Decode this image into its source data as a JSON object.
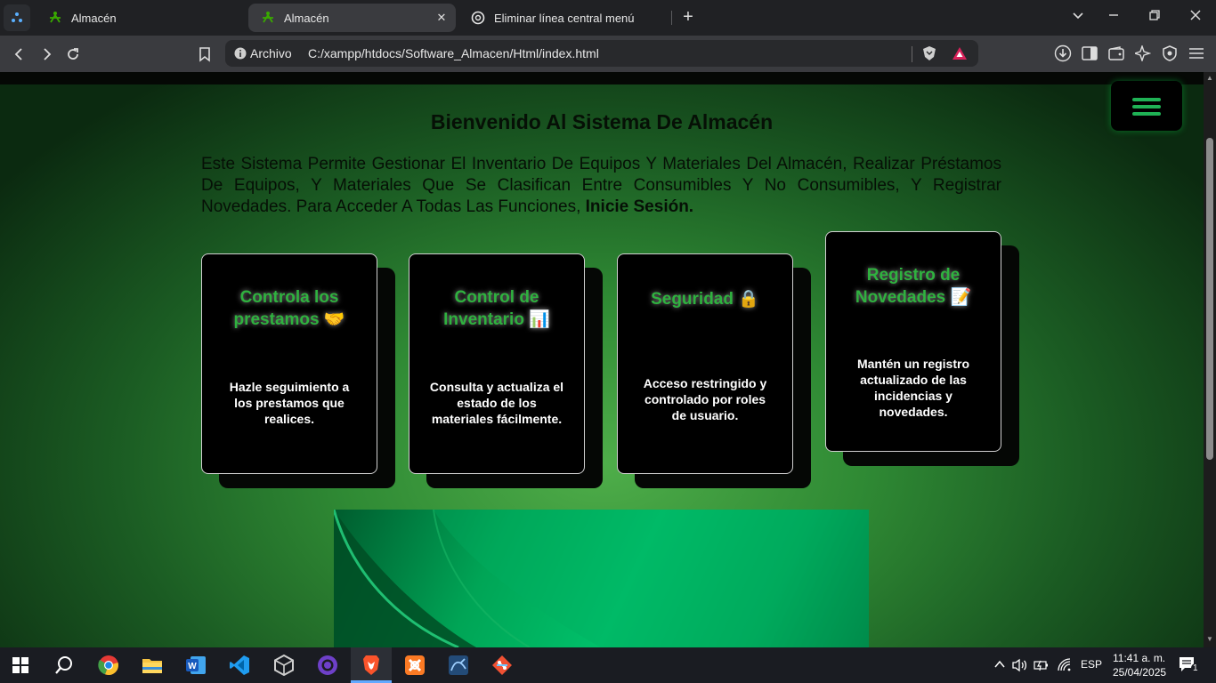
{
  "browser": {
    "tabs": [
      {
        "label": "Almacén",
        "active": false,
        "icon": "sena-logo-icon"
      },
      {
        "label": "Almacén",
        "active": true,
        "icon": "sena-logo-icon"
      },
      {
        "label": "Eliminar línea central menú",
        "active": false,
        "icon": "chatgpt-icon"
      }
    ],
    "new_tab_label": "+",
    "address": {
      "scheme_label": "Archivo",
      "url": "C:/xampp/htdocs/Software_Almacen/Html/index.html"
    }
  },
  "page": {
    "title": "Bienvenido Al Sistema De Almacén",
    "intro_text": "Este Sistema Permite Gestionar El Inventario De Equipos Y Materiales Del Almacén, Realizar Préstamos De Equipos, Y Materiales Que Se Clasifican Entre Consumibles Y No Consumibles, Y Registrar Novedades. Para Acceder A Todas Las Funciones,",
    "intro_link": "Inicie Sesión.",
    "cards": [
      {
        "title": "Controla los prestamos 🤝",
        "text": "Hazle seguimiento a los prestamos que realices."
      },
      {
        "title": "Control de Inventario 📊",
        "text": "Consulta y actualiza el estado de los materiales fácilmente."
      },
      {
        "title": "Seguridad 🔒",
        "text": "Acceso restringido y controlado por roles de usuario."
      },
      {
        "title": "Registro de Novedades 📝",
        "text": "Mantén un registro actualizado de las incidencias y novedades."
      }
    ]
  },
  "taskbar": {
    "apps": [
      "windows-start-icon",
      "search-icon",
      "chrome-icon",
      "file-explorer-icon",
      "word-icon",
      "vscode-icon",
      "unity-icon",
      "github-desktop-icon",
      "brave-icon",
      "xampp-icon",
      "mysql-workbench-icon",
      "git-icon"
    ],
    "language": "ESP",
    "time": "11:41 a. m.",
    "date": "25/04/2025",
    "notification_count": "1"
  },
  "colors": {
    "accent_green": "#2fb23f",
    "card_bg": "#000000",
    "browser_bg": "#202124",
    "taskbar_bg": "#1a1c22"
  }
}
